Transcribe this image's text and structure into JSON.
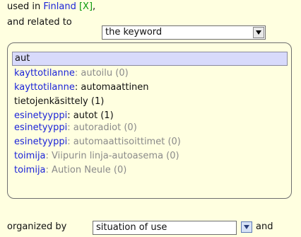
{
  "header": {
    "used_in": "used in",
    "country": "Finland",
    "remove": "[X]",
    "comma": ",",
    "related_label": "and related to",
    "related_value": "the keyword"
  },
  "search": {
    "value": "aut"
  },
  "suggestions": [
    {
      "type": "kayttotilanne",
      "sep": ": ",
      "term": "autoilu (0)",
      "available": false
    },
    {
      "type": "kayttotilanne",
      "sep": ": ",
      "term": "automaattinen",
      "available": true
    },
    {
      "type": "",
      "sep": "",
      "term": "tietojenkäsittely (1)",
      "available": true
    },
    {
      "type": "esinetyyppi",
      "sep": ": ",
      "term": "autot (1)",
      "available": true
    },
    {
      "type": "esinetyyppi",
      "sep": ": ",
      "term": "autoradiot (0)",
      "available": false
    },
    {
      "type": "esinetyyppi",
      "sep": ": ",
      "term": "automaattisoittimet (0)",
      "available": false
    },
    {
      "type": "toimija",
      "sep": ": ",
      "term": "Viipurin linja-autoasema (0)",
      "available": false
    },
    {
      "type": "toimija",
      "sep": ": ",
      "term": "Aution Neule (0)",
      "available": false
    }
  ],
  "footer": {
    "organized_label": "organized by",
    "organized_value": "situation of use",
    "and_label": "and"
  },
  "colors": {
    "background": "#ffffe0",
    "link": "#1c24d8",
    "muted": "#8a8a8a",
    "highlight": "#d8dafb"
  },
  "icons": {
    "dropdown": "chevron-down-icon"
  }
}
